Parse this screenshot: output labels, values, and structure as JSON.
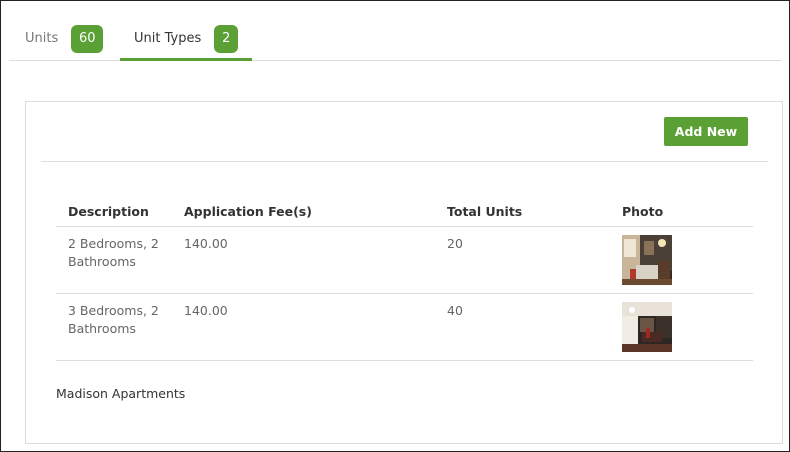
{
  "tabs": [
    {
      "label": "Units",
      "count": "60"
    },
    {
      "label": "Unit Types",
      "count": "2"
    }
  ],
  "toolbar": {
    "add_new_label": "Add New"
  },
  "table": {
    "headers": {
      "description": "Description",
      "fee": "Application Fee(s)",
      "total": "Total Units",
      "photo": "Photo"
    },
    "rows": [
      {
        "description": "2 Bedrooms, 2 Bathrooms",
        "fee": "140.00",
        "total": "20"
      },
      {
        "description": "3 Bedrooms, 2 Bathrooms",
        "fee": "140.00",
        "total": "40"
      }
    ]
  },
  "footer": {
    "property_name": "Madison Apartments"
  },
  "colors": {
    "accent": "#5aa034",
    "border": "#dddddd",
    "text": "#333333",
    "muted": "#666666"
  }
}
